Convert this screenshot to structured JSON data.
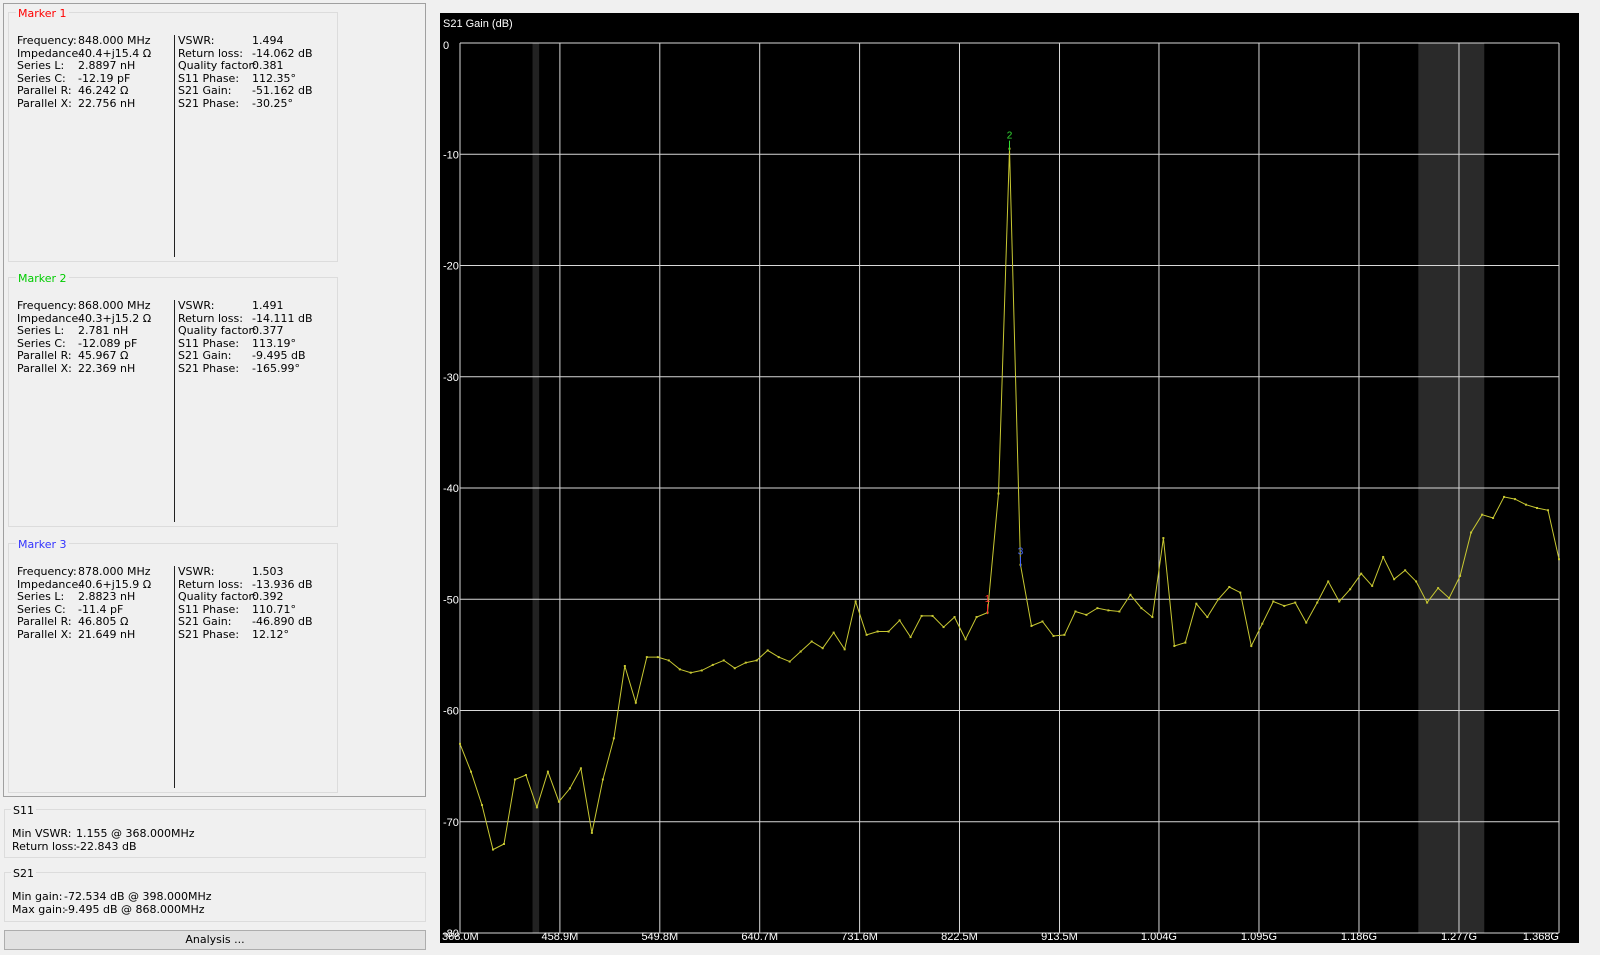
{
  "markers": [
    {
      "title": "Marker 1",
      "color": "#ff0000",
      "left": [
        {
          "label": "Frequency:",
          "value": "848.000 MHz"
        },
        {
          "label": "Impedance:",
          "value": "40.4+j15.4 Ω"
        },
        {
          "label": "Series L:",
          "value": "2.8897 nH"
        },
        {
          "label": "Series C:",
          "value": "-12.19 pF"
        },
        {
          "label": "Parallel R:",
          "value": "46.242 Ω"
        },
        {
          "label": "Parallel X:",
          "value": "22.756 nH"
        }
      ],
      "right": [
        {
          "label": "VSWR:",
          "value": "1.494"
        },
        {
          "label": "Return loss:",
          "value": "-14.062 dB"
        },
        {
          "label": "Quality factor:",
          "value": "0.381"
        },
        {
          "label": "S11 Phase:",
          "value": "112.35°"
        },
        {
          "label": "S21 Gain:",
          "value": "-51.162 dB"
        },
        {
          "label": "S21 Phase:",
          "value": "-30.25°"
        }
      ]
    },
    {
      "title": "Marker 2",
      "color": "#00cc00",
      "left": [
        {
          "label": "Frequency:",
          "value": "868.000 MHz"
        },
        {
          "label": "Impedance:",
          "value": "40.3+j15.2 Ω"
        },
        {
          "label": "Series L:",
          "value": "2.781 nH"
        },
        {
          "label": "Series C:",
          "value": "-12.089 pF"
        },
        {
          "label": "Parallel R:",
          "value": "45.967 Ω"
        },
        {
          "label": "Parallel X:",
          "value": "22.369 nH"
        }
      ],
      "right": [
        {
          "label": "VSWR:",
          "value": "1.491"
        },
        {
          "label": "Return loss:",
          "value": "-14.111 dB"
        },
        {
          "label": "Quality factor:",
          "value": "0.377"
        },
        {
          "label": "S11 Phase:",
          "value": "113.19°"
        },
        {
          "label": "S21 Gain:",
          "value": "-9.495 dB"
        },
        {
          "label": "S21 Phase:",
          "value": "-165.99°"
        }
      ]
    },
    {
      "title": "Marker 3",
      "color": "#3333ff",
      "left": [
        {
          "label": "Frequency:",
          "value": "878.000 MHz"
        },
        {
          "label": "Impedance:",
          "value": "40.6+j15.9 Ω"
        },
        {
          "label": "Series L:",
          "value": "2.8823 nH"
        },
        {
          "label": "Series C:",
          "value": "-11.4 pF"
        },
        {
          "label": "Parallel R:",
          "value": "46.805 Ω"
        },
        {
          "label": "Parallel X:",
          "value": "21.649 nH"
        }
      ],
      "right": [
        {
          "label": "VSWR:",
          "value": "1.503"
        },
        {
          "label": "Return loss:",
          "value": "-13.936 dB"
        },
        {
          "label": "Quality factor:",
          "value": "0.392"
        },
        {
          "label": "S11 Phase:",
          "value": "110.71°"
        },
        {
          "label": "S21 Gain:",
          "value": "-46.890 dB"
        },
        {
          "label": "S21 Phase:",
          "value": "12.12°"
        }
      ]
    }
  ],
  "s11": {
    "title": "S11",
    "min_vswr_label": "Min VSWR:",
    "min_vswr_value": "1.155 @ 368.000MHz",
    "return_loss_label": "Return loss:",
    "return_loss_value": "-22.843 dB"
  },
  "s21": {
    "title": "S21",
    "min_gain_label": "Min gain:",
    "min_gain_value": "-72.534 dB @ 398.000MHz",
    "max_gain_label": "Max gain:",
    "max_gain_value": "-9.495 dB @ 868.000MHz"
  },
  "analysis_button": "Analysis ...",
  "chart_data": {
    "type": "line",
    "title": "S21 Gain (dB)",
    "xlabel": "",
    "ylabel": "",
    "x_unit": "MHz",
    "xlim": [
      368,
      1368
    ],
    "ylim": [
      -80,
      0
    ],
    "grid": true,
    "x_ticks": [
      368,
      458.9,
      549.8,
      640.7,
      731.6,
      822.5,
      913.5,
      1004,
      1095,
      1186,
      1277,
      1368
    ],
    "x_tick_labels": [
      "368.0M",
      "458.9M",
      "549.8M",
      "640.7M",
      "731.6M",
      "822.5M",
      "913.5M",
      "1.004G",
      "1.095G",
      "1.186G",
      "1.277G",
      "1.368G"
    ],
    "y_ticks": [
      0,
      -10,
      -20,
      -30,
      -40,
      -50,
      -60,
      -70,
      -80
    ],
    "y_tick_labels": [
      "0",
      "-10",
      "-20",
      "-30",
      "-40",
      "-50",
      "-60",
      "-70",
      "-80"
    ],
    "background_color": "#000000",
    "grid_color": "#d8d8d8",
    "trace_color": "#c8c832",
    "shaded_bands": [
      {
        "from": 434,
        "to": 440,
        "color": "#222222"
      },
      {
        "from": 1240,
        "to": 1300,
        "color": "#2a2a2a"
      }
    ],
    "series": [
      {
        "x": [
          368,
          378,
          388,
          398,
          408,
          418,
          428,
          438,
          448,
          458,
          468,
          478,
          488,
          498,
          508,
          518,
          528,
          538,
          548,
          558,
          568,
          578,
          588,
          598,
          608,
          618,
          628,
          638,
          648,
          658,
          668,
          678,
          688,
          698,
          708,
          718,
          728,
          738,
          748,
          758,
          768,
          778,
          788,
          798,
          808,
          818,
          828,
          838,
          848,
          858,
          868,
          878,
          888,
          898,
          908,
          918,
          928,
          938,
          948,
          958,
          968,
          978,
          988,
          998,
          1008,
          1018,
          1028,
          1038,
          1048,
          1058,
          1068,
          1078,
          1088,
          1098,
          1108,
          1118,
          1128,
          1138,
          1148,
          1158,
          1168,
          1178,
          1188,
          1198,
          1208,
          1218,
          1228,
          1238,
          1248,
          1258,
          1268,
          1278,
          1288,
          1298,
          1308,
          1318,
          1328,
          1338,
          1348,
          1358,
          1368
        ],
        "values": [
          -63,
          -65.5,
          -68.5,
          -72.5,
          -72,
          -66.2,
          -65.8,
          -68.7,
          -65.5,
          -68.2,
          -67,
          -65.2,
          -71,
          -66.2,
          -62.5,
          -56,
          -59.3,
          -55.2,
          -55.2,
          -55.5,
          -56.3,
          -56.6,
          -56.4,
          -55.9,
          -55.5,
          -56.2,
          -55.7,
          -55.5,
          -54.6,
          -55.2,
          -55.6,
          -54.7,
          -53.8,
          -54.4,
          -53,
          -54.5,
          -50.2,
          -53.2,
          -52.9,
          -52.9,
          -51.9,
          -53.4,
          -51.5,
          -51.5,
          -52.5,
          -51.6,
          -53.6,
          -51.6,
          -51.2,
          -40.5,
          -9.5,
          -46.9,
          -52.4,
          -52,
          -53.3,
          -53.2,
          -51.1,
          -51.4,
          -50.8,
          -51,
          -51.1,
          -49.6,
          -50.8,
          -51.6,
          -44.5,
          -54.2,
          -53.9,
          -50.4,
          -51.6,
          -50,
          -48.9,
          -49.4,
          -54.2,
          -52.2,
          -50.2,
          -50.6,
          -50.3,
          -52.1,
          -50.3,
          -48.4,
          -50.2,
          -49.1,
          -47.7,
          -48.8,
          -46.2,
          -48.2,
          -47.4,
          -48.4,
          -50.3,
          -49,
          -49.9,
          -47.9,
          -44,
          -42.4,
          -42.7,
          -40.8,
          -41,
          -41.5,
          -41.8,
          -42,
          -46.4
        ]
      }
    ],
    "markers": [
      {
        "label": "1",
        "x": 848,
        "y": -51.162,
        "color": "#ff3030"
      },
      {
        "label": "2",
        "x": 868,
        "y": -9.495,
        "color": "#33dd33"
      },
      {
        "label": "3",
        "x": 878,
        "y": -46.89,
        "color": "#4466ff"
      }
    ]
  }
}
